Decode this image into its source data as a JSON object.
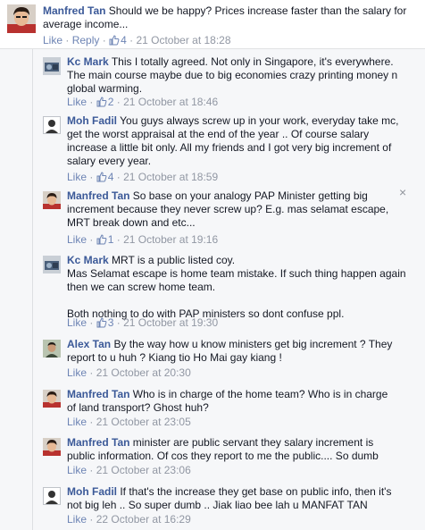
{
  "top_comment": {
    "author": "Manfred Tan",
    "text_line1": "Should we be happy? Prices increase faster than the salary for",
    "text_line2": "average income...",
    "like": "Like",
    "reply": "Reply",
    "likes": "4",
    "time": "21 October at 18:28"
  },
  "replies": [
    {
      "author": "Kc Mark",
      "lines": [
        "This I totally agreed. Not only in Singapore, it's everywhere.",
        "The main course maybe due to big economies crazy printing money n",
        "global warming."
      ],
      "like": "Like",
      "likes": "2",
      "time": "21 October at 18:46"
    },
    {
      "author": "Moh Fadil",
      "lines": [
        "You guys always screw up in your work, everyday take mc,",
        "get the worst appraisal at the end of the year .. Of course salary",
        "increase a little bit only. All my friends and I got very big increment of",
        "salary every year."
      ],
      "like": "Like",
      "likes": "4",
      "time": "21 October at 18:59"
    },
    {
      "author": "Manfred Tan",
      "lines": [
        "So base on your analogy PAP Minister getting big",
        "increment because they never screw up? E.g. mas selamat escape,",
        "MRT break down and etc..."
      ],
      "like": "Like",
      "likes": "1",
      "time": "21 October at 19:16"
    },
    {
      "author": "Kc Mark",
      "lines": [
        "MRT is a public listed coy.",
        "Mas Selamat escape is home team mistake. If such thing happen again",
        "then we can screw home team.",
        "",
        "Both nothing to do with PAP ministers so dont confuse ppl."
      ],
      "like": "Like",
      "likes": "3",
      "time": "21 October at 19:30"
    },
    {
      "author": "Alex Tan",
      "lines": [
        "By the way how u know ministers get big increment ? They",
        "report to u huh ? Kiang tio Ho Mai gay kiang !"
      ],
      "like": "Like",
      "time": "21 October at 20:30"
    },
    {
      "author": "Manfred Tan",
      "lines": [
        "Who is in charge of the home team? Who is in charge",
        "of land transport? Ghost huh?"
      ],
      "like": "Like",
      "time": "21 October at 23:05"
    },
    {
      "author": "Manfred Tan",
      "lines": [
        "minister are public servant they salary increment is",
        "public information. Of cos they report to me the public.... So dumb"
      ],
      "like": "Like",
      "time": "21 October at 23:06"
    },
    {
      "author": "Moh Fadil",
      "lines": [
        "If that's the increase they get base on public info, then it's",
        "not big leh .. So super dumb .. Jiak liao bee lah u MANFAT TAN"
      ],
      "like": "Like",
      "time": "22 October at 16:29"
    }
  ],
  "icons": {
    "close": "×",
    "thumb": "thumbs-up-icon",
    "dot": "·"
  },
  "colors": {
    "name": "#3b5998",
    "link": "#6d84b4",
    "meta": "#9197a3",
    "background": "#f6f7f9"
  }
}
